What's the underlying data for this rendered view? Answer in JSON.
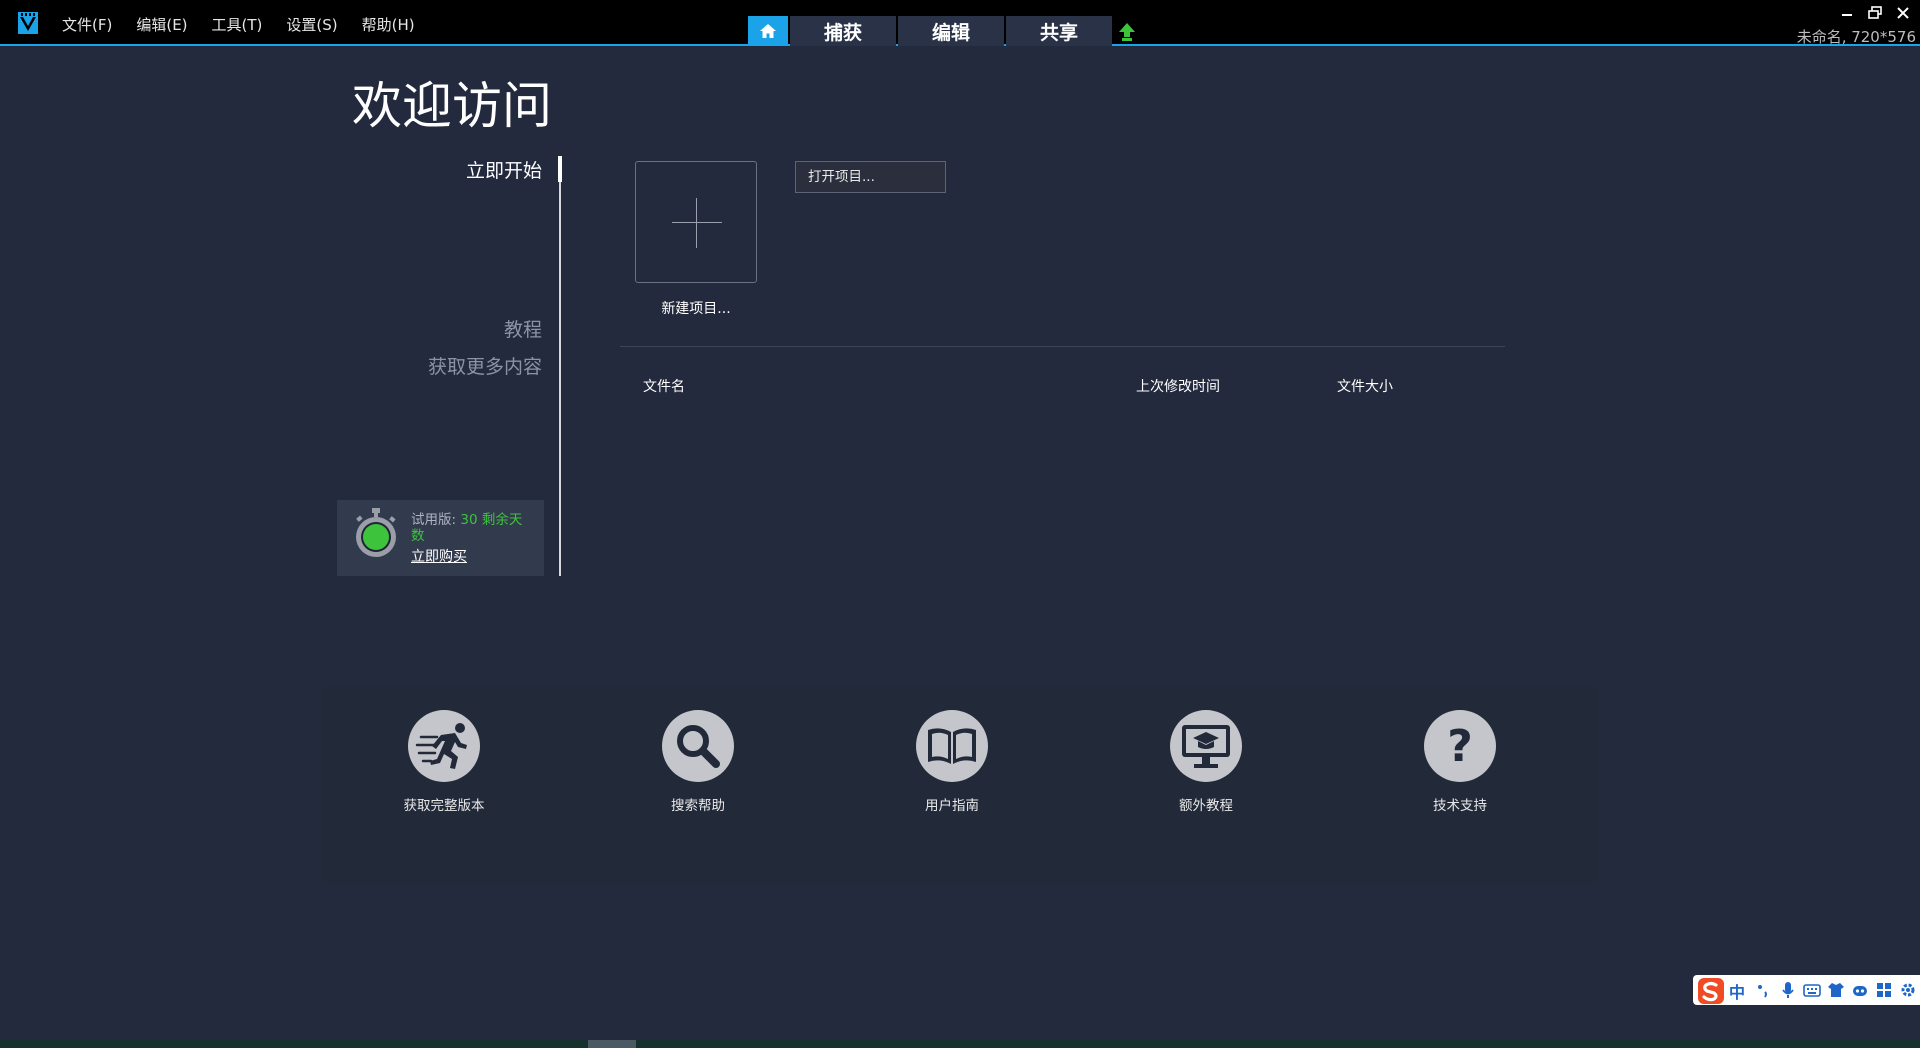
{
  "menubar": {
    "items": [
      "文件(F)",
      "编辑(E)",
      "工具(T)",
      "设置(S)",
      "帮助(H)"
    ]
  },
  "mode_tabs": {
    "home_icon": "home-icon",
    "tabs": [
      "捕获",
      "编辑",
      "共享"
    ],
    "upload_icon": "upload-arrow-icon"
  },
  "project_info": "未命名, 720*576",
  "welcome": {
    "title": "欢迎访问"
  },
  "side_nav": {
    "items": [
      "立即开始",
      "教程",
      "获取更多内容"
    ]
  },
  "trial": {
    "prefix": "试用版:",
    "days": "30 剩余天数",
    "buy_now": "立即购买"
  },
  "main": {
    "new_project_label": "新建项目...",
    "open_project_label": "打开项目...",
    "columns": [
      "文件名",
      "上次修改时间",
      "文件大小"
    ]
  },
  "quick_links": [
    {
      "label": "获取完整版本",
      "icon": "running-man-icon"
    },
    {
      "label": "搜索帮助",
      "icon": "magnifier-icon"
    },
    {
      "label": "用户指南",
      "icon": "open-book-icon"
    },
    {
      "label": "额外教程",
      "icon": "monitor-graduation-cap-icon"
    },
    {
      "label": "技术支持",
      "icon": "question-mark-icon"
    }
  ],
  "ime": {
    "lang": "中"
  },
  "colors": {
    "accent": "#1aa3e8",
    "background": "#232a3e",
    "trial_green": "#3ec33c"
  }
}
